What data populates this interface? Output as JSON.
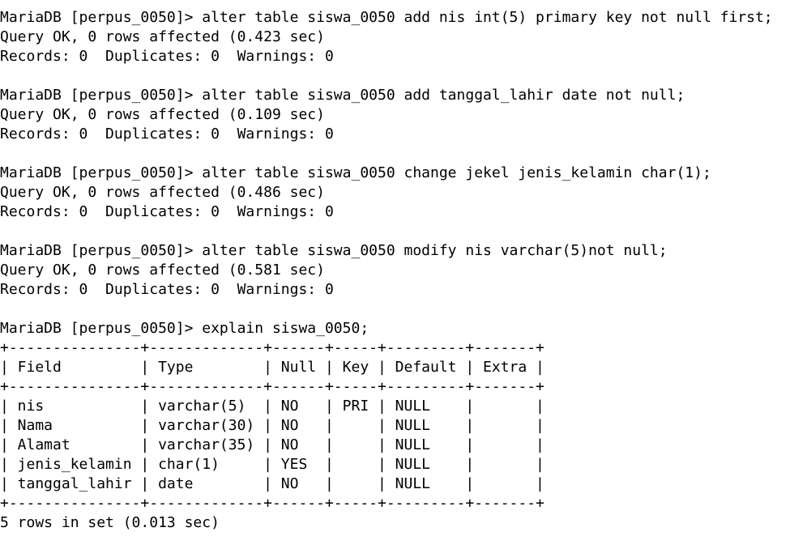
{
  "terminal": {
    "lines": [
      "MariaDB [perpus_0050]> alter table siswa_0050 add nis int(5) primary key not null first;",
      "Query OK, 0 rows affected (0.423 sec)",
      "Records: 0  Duplicates: 0  Warnings: 0",
      "",
      "MariaDB [perpus_0050]> alter table siswa_0050 add tanggal_lahir date not null;",
      "Query OK, 0 rows affected (0.109 sec)",
      "Records: 0  Duplicates: 0  Warnings: 0",
      "",
      "MariaDB [perpus_0050]> alter table siswa_0050 change jekel jenis_kelamin char(1);",
      "Query OK, 0 rows affected (0.486 sec)",
      "Records: 0  Duplicates: 0  Warnings: 0",
      "",
      "MariaDB [perpus_0050]> alter table siswa_0050 modify nis varchar(5)not null;",
      "Query OK, 0 rows affected (0.581 sec)",
      "Records: 0  Duplicates: 0  Warnings: 0",
      "",
      "MariaDB [perpus_0050]> explain siswa_0050;",
      "+---------------+-------------+------+-----+---------+-------+",
      "| Field         | Type        | Null | Key | Default | Extra |",
      "+---------------+-------------+------+-----+---------+-------+",
      "| nis           | varchar(5)  | NO   | PRI | NULL    |       |",
      "| Nama          | varchar(30) | NO   |     | NULL    |       |",
      "| Alamat        | varchar(35) | NO   |     | NULL    |       |",
      "| jenis_kelamin | char(1)     | YES  |     | NULL    |       |",
      "| tanggal_lahir | date        | NO   |     | NULL    |       |",
      "+---------------+-------------+------+-----+---------+-------+",
      "5 rows in set (0.013 sec)"
    ]
  },
  "colors": {
    "background": "#ffffff",
    "text": "#000000"
  }
}
